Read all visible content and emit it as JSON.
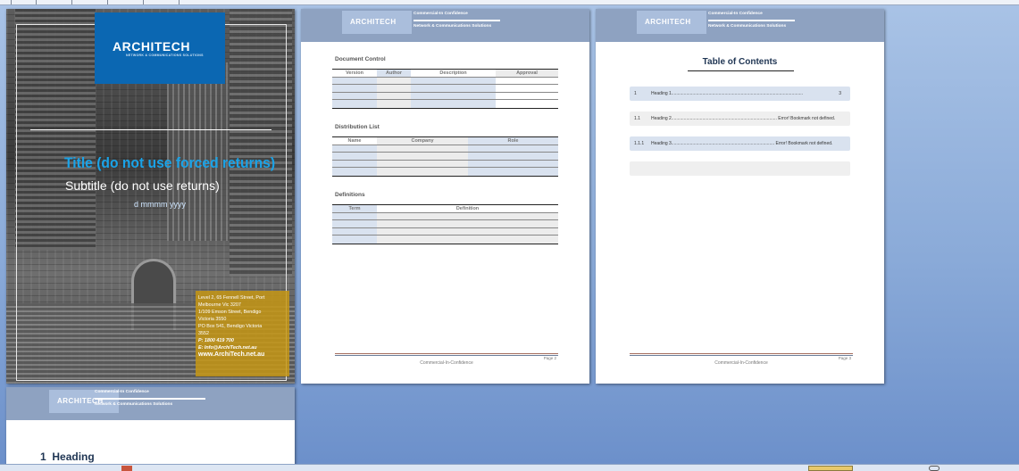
{
  "cover": {
    "logo": "ARCHITECH",
    "logo_tagline": "NETWORK & COMMUNICATIONS SOLUTIONS",
    "title": "Title (do not use forced returns)",
    "subtitle": "Subtitle (do not use returns)",
    "date": "d mmmm yyyy",
    "address": {
      "line1": "Level 2, 65 Fennell Street, Port",
      "line2": "Melbourne Vic 3207",
      "line3": "1/109 Emson Street, Bendigo",
      "line4": "Victoria 3550",
      "line5": "PO Box 541, Bendigo Victoria",
      "line6": "3552",
      "phone": "P: 1800 419 700",
      "email": "E: Info@ArchiTech.net.au",
      "web": "www.ArchiTech.net.au"
    }
  },
  "header": {
    "logo": "ARCHITECH",
    "line1": "Commercial-In Confidence",
    "line2": "Network & Communications Solutions"
  },
  "page2": {
    "doc_control": {
      "heading": "Document Control",
      "columns": [
        "Version",
        "Author",
        "Description",
        "Approval"
      ]
    },
    "dist_list": {
      "heading": "Distribution List",
      "columns": [
        "Name",
        "Company",
        "Role"
      ]
    },
    "definitions": {
      "heading": "Definitions",
      "columns": [
        "Term",
        "Definition"
      ]
    },
    "footer_page": "Page 2",
    "footer_conf": "Commercial-In-Confidence"
  },
  "page3": {
    "toc_title": "Table of Contents",
    "entries": [
      {
        "num": "1",
        "text": "Heading 1..........................................................................................................",
        "page": "3"
      },
      {
        "num": "1.1",
        "text": "Heading 2..................................................................................... Error! Bookmark not defined.",
        "page": ""
      },
      {
        "num": "1.1.1",
        "text": "Heading 3................................................................................... Error! Bookmark not defined.",
        "page": ""
      }
    ],
    "footer_page": "Page 3",
    "footer_conf": "Commercial-In-Confidence"
  },
  "page4": {
    "heading_num": "1",
    "heading": "Heading"
  },
  "colors": {
    "header_band": "#8ea2c1",
    "logo_blue": "#0b67b2",
    "title_blue": "#1aa3e8",
    "address_gold": "#c69614",
    "background": "#8aaad8"
  }
}
